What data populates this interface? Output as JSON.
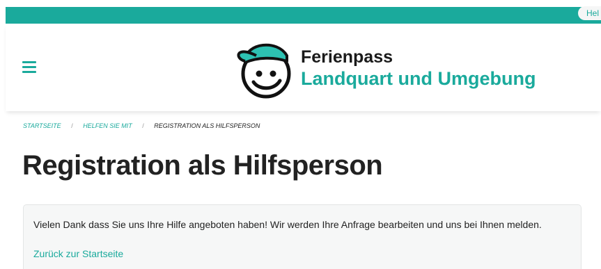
{
  "top_bar": {
    "help_label": "Hel"
  },
  "header": {
    "brand_name": "Ferienpass",
    "brand_subtitle": "Landquart und Umgebung",
    "menu_icon": "hamburger-icon",
    "logo_icon": "smiley-cap-logo"
  },
  "breadcrumb": {
    "items": [
      "STARTSEITE",
      "HELFEN SIE MIT",
      "REGISTRATION ALS HILFSPERSON"
    ],
    "separator": "/"
  },
  "main": {
    "title": "Registration als Hilfsperson",
    "notice_text": "Vielen Dank dass Sie uns Ihre Hilfe angeboten haben! Wir werden Ihre Anfrage bearbeiten und uns bei Ihnen melden.",
    "back_link": "Zurück zur Startseite"
  },
  "colors": {
    "accent": "#1aaa9c",
    "text": "#222222",
    "notice_bg": "#f6f7f7"
  }
}
